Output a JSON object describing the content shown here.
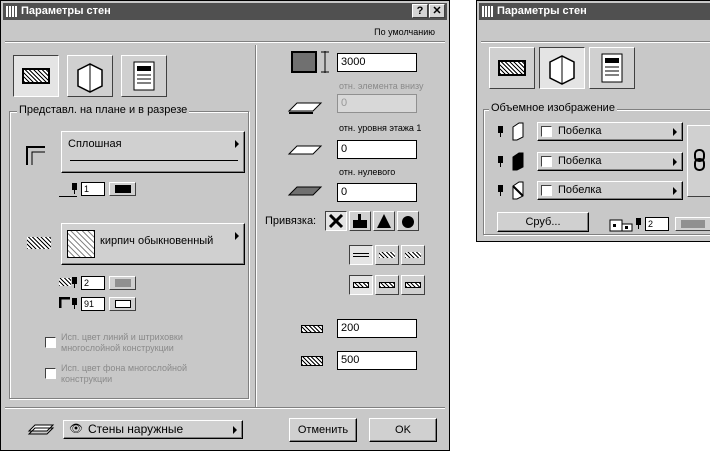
{
  "left_window": {
    "title": "Параметры стен",
    "help_button": "?",
    "close_button": "✕",
    "defaults_label": "По умолчанию",
    "group_plan_section": "Представл. на плане и в разрезе",
    "line_type": "Сплошная",
    "line_pen": "1",
    "fill_type": "кирпич обыкновенный",
    "fill_pen": "2",
    "bg_pen": "91",
    "checkbox_use_color_lines": "Исп. цвет линий и штриховки многослойной конструкции",
    "checkbox_use_bg_color": "Исп. цвет фона многослойной конструкции",
    "height_value": "3000",
    "label_rel_element_below": "отн. элемента внизу",
    "offset_below_value": "0",
    "label_rel_floor_level": "отн. уровня этажа 1",
    "floor_offset_value": "0",
    "label_rel_zero": "отн. нулевого",
    "zero_offset_value": "0",
    "anchor_label": "Привязка:",
    "thickness_value": "200",
    "height2_value": "500",
    "layer_name": "Стены наружные",
    "cancel_button": "Отменить",
    "ok_button": "OK"
  },
  "right_window": {
    "title": "Параметры стен",
    "group_3d": "Объемное изображение",
    "material_1": "Побелка",
    "material_2": "Побелка",
    "material_3": "Побелка",
    "log_button": "Сруб...",
    "pen_value": "2"
  }
}
